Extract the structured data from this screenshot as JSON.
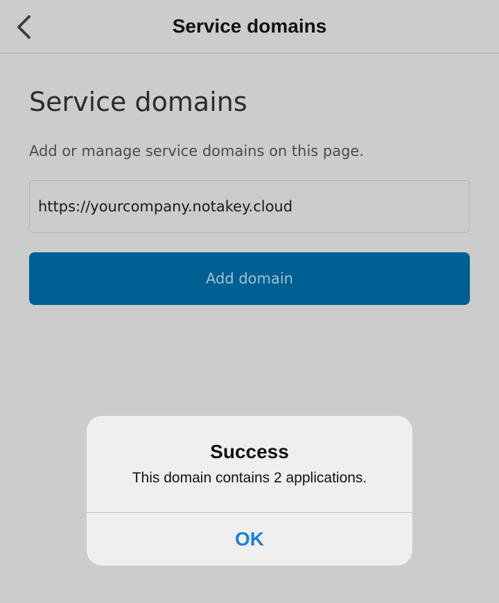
{
  "navbar": {
    "title": "Service domains",
    "back_icon": "chevron-left-icon"
  },
  "main": {
    "title": "Service domains",
    "description": "Add or manage service domains on this page.",
    "domain_input": {
      "value": "https://yourcompany.notakey.cloud",
      "placeholder": ""
    },
    "add_button_label": "Add domain"
  },
  "alert": {
    "title": "Success",
    "message": "This domain contains 2 applications.",
    "ok_label": "OK"
  },
  "colors": {
    "background": "#cccccc",
    "primary_button": "#005f93",
    "primary_button_text": "#a6c0d3",
    "alert_background": "#efefef",
    "alert_action": "#1b7fd6"
  }
}
